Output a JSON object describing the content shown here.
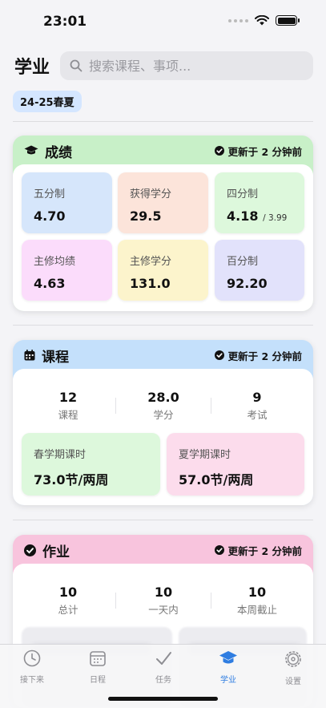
{
  "status_bar": {
    "time": "23:01"
  },
  "header": {
    "title": "学业",
    "search_placeholder": "搜索课程、事项..."
  },
  "term": "24-25春夏",
  "grades": {
    "title": "成绩",
    "updated": "更新于 2 分钟前",
    "tiles": [
      {
        "label": "五分制",
        "value": "4.70",
        "color": "#d6e6fb"
      },
      {
        "label": "获得学分",
        "value": "29.5",
        "color": "#fce4da"
      },
      {
        "label": "四分制",
        "value": "4.18",
        "sub": "/ 3.99",
        "color": "#ddf8dc"
      },
      {
        "label": "主修均绩",
        "value": "4.63",
        "color": "#fbdcfb"
      },
      {
        "label": "主修学分",
        "value": "131.0",
        "color": "#fcf4cc"
      },
      {
        "label": "百分制",
        "value": "92.20",
        "color": "#e2e2fb"
      }
    ]
  },
  "courses": {
    "title": "课程",
    "updated": "更新于 2 分钟前",
    "stats": [
      {
        "value": "12",
        "label": "课程"
      },
      {
        "value": "28.0",
        "label": "学分"
      },
      {
        "value": "9",
        "label": "考试"
      }
    ],
    "hours": [
      {
        "label": "春学期课时",
        "value": "73.0节/两周",
        "color": "#ddf8dc"
      },
      {
        "label": "夏学期课时",
        "value": "57.0节/两周",
        "color": "#fcdcec"
      }
    ]
  },
  "homework": {
    "title": "作业",
    "updated": "更新于 2 分钟前",
    "stats": [
      {
        "value": "10",
        "label": "总计"
      },
      {
        "value": "10",
        "label": "一天内"
      },
      {
        "value": "10",
        "label": "本周截止"
      }
    ]
  },
  "tab_bar": {
    "items": [
      {
        "label": "接下来",
        "icon": "clock-icon"
      },
      {
        "label": "日程",
        "icon": "calendar-icon"
      },
      {
        "label": "任务",
        "icon": "checkmark-icon"
      },
      {
        "label": "学业",
        "icon": "graduation-cap-icon",
        "active": true
      },
      {
        "label": "设置",
        "icon": "gear-icon"
      }
    ],
    "active_color": "#2f7de1",
    "inactive_color": "#8e8e93"
  }
}
